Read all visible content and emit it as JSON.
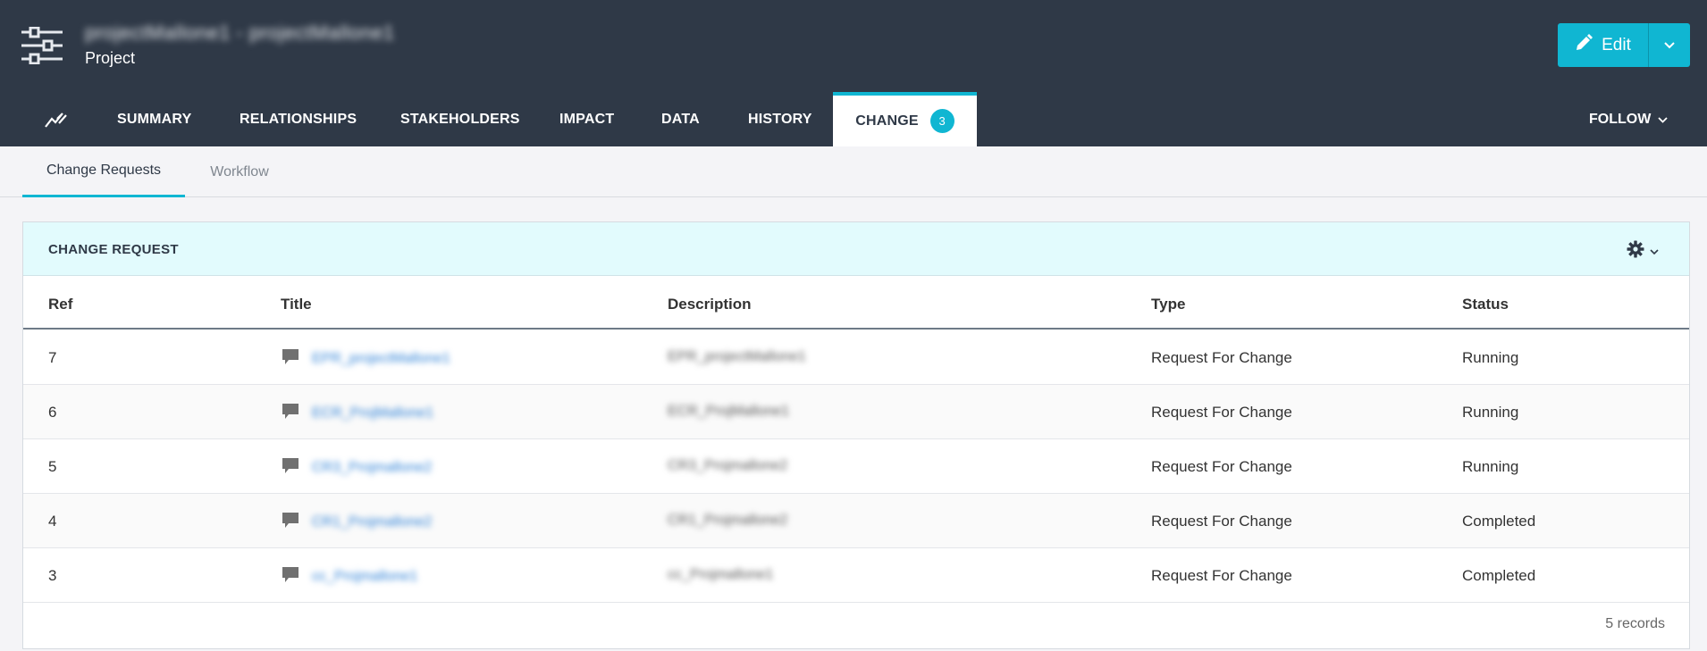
{
  "header": {
    "title": "projectMallone1 - projectMallone1",
    "subtitle": "Project",
    "edit_label": "Edit"
  },
  "nav": {
    "tabs": [
      {
        "label": "SUMMARY"
      },
      {
        "label": "RELATIONSHIPS"
      },
      {
        "label": "STAKEHOLDERS"
      },
      {
        "label": "IMPACT"
      },
      {
        "label": "DATA"
      },
      {
        "label": "HISTORY"
      },
      {
        "label": "CHANGE",
        "badge": "3",
        "active": true
      }
    ],
    "follow_label": "FOLLOW"
  },
  "subtabs": [
    {
      "label": "Change Requests",
      "active": true
    },
    {
      "label": "Workflow",
      "active": false
    }
  ],
  "panel": {
    "title": "CHANGE REQUEST",
    "columns": [
      "Ref",
      "Title",
      "Description",
      "Type",
      "Status"
    ],
    "rows": [
      {
        "ref": "7",
        "title": "EPR_projectMallone1",
        "description": "EPR_projectMallone1",
        "type": "Request For Change",
        "status": "Running"
      },
      {
        "ref": "6",
        "title": "ECR_ProjMallone1",
        "description": "ECR_ProjMallone1",
        "type": "Request For Change",
        "status": "Running"
      },
      {
        "ref": "5",
        "title": "CR3_Projmallone2",
        "description": "CR3_Projmallone2",
        "type": "Request For Change",
        "status": "Running"
      },
      {
        "ref": "4",
        "title": "CR1_Projmallone2",
        "description": "CR1_Projmallone2",
        "type": "Request For Change",
        "status": "Completed"
      },
      {
        "ref": "3",
        "title": "cc_Projmallone1",
        "description": "cc_Projmallone1",
        "type": "Request For Change",
        "status": "Completed"
      }
    ],
    "footer": "5 records"
  },
  "colors": {
    "header_bg": "#2f3947",
    "accent": "#10b6d2",
    "panel_header_bg": "#e2fbfd",
    "link": "#2a7fd6"
  },
  "icons": {
    "app": "sliders-icon",
    "nav_first": "activity-chart-icon",
    "edit": "pencil-icon",
    "row": "comment-icon",
    "settings": "gear-icon"
  }
}
